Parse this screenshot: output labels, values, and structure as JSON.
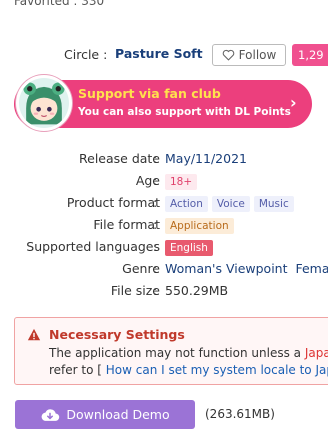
{
  "top_cut_text": "Favorited : 330",
  "circle": {
    "label": "Circle :",
    "name": "Pasture Soft",
    "follow_label": "Follow",
    "follow_count": "1,29"
  },
  "fanclub": {
    "title": "Support via fan club",
    "subtitle": "You can also support with DL Points",
    "chevron": "›"
  },
  "info": {
    "release_date": {
      "label": "Release date",
      "value": "May/11/2021"
    },
    "age": {
      "label": "Age",
      "value": "18+"
    },
    "product_format": {
      "label": "Product format",
      "tags": [
        "Action",
        "Voice",
        "Music"
      ]
    },
    "file_format": {
      "label": "File format",
      "value": "Application"
    },
    "languages": {
      "label": "Supported languages",
      "value": "English"
    },
    "genre": {
      "label": "Genre",
      "values": [
        "Woman's Viewpoint",
        "Fema"
      ]
    },
    "file_size": {
      "label": "File size",
      "value": "550.29MB"
    },
    "colon": ":"
  },
  "warning": {
    "title": "Necessary Settings",
    "line1_prefix": "The application may not function unless a ",
    "line1_red": "Japan",
    "line2_prefix": "refer to [ ",
    "line2_link": "How can I set my system locale to Jap"
  },
  "download": {
    "label": "Download Demo",
    "size": "(263.61MB)"
  },
  "colors": {
    "pink": "#ec3f7d",
    "purple_button": "#9b73d6",
    "link_navy": "#1a3f7a"
  }
}
